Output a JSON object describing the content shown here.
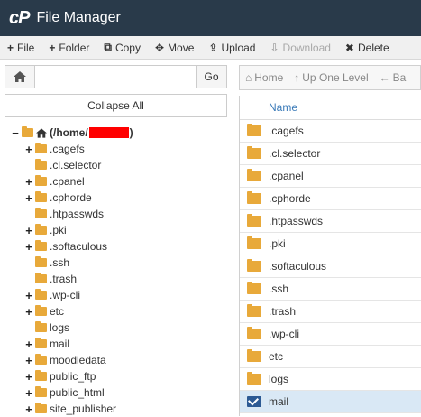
{
  "header": {
    "logo": "cP",
    "title": "File Manager"
  },
  "toolbar": [
    {
      "icon": "+",
      "label": "File",
      "name": "new-file-button",
      "disabled": false
    },
    {
      "icon": "+",
      "label": "Folder",
      "name": "new-folder-button",
      "disabled": false
    },
    {
      "icon": "⧉",
      "label": "Copy",
      "name": "copy-button",
      "disabled": false
    },
    {
      "icon": "✥",
      "label": "Move",
      "name": "move-button",
      "disabled": false
    },
    {
      "icon": "⇪",
      "label": "Upload",
      "name": "upload-button",
      "disabled": false
    },
    {
      "icon": "⇩",
      "label": "Download",
      "name": "download-button",
      "disabled": true
    },
    {
      "icon": "✖",
      "label": "Delete",
      "name": "delete-button",
      "disabled": false
    }
  ],
  "left": {
    "path_value": "",
    "go_label": "Go",
    "collapse_label": "Collapse All",
    "root_label": "(/home/",
    "root_suffix": ")",
    "tree": [
      {
        "label": ".cagefs",
        "toggle": "+"
      },
      {
        "label": ".cl.selector",
        "toggle": ""
      },
      {
        "label": ".cpanel",
        "toggle": "+"
      },
      {
        "label": ".cphorde",
        "toggle": "+"
      },
      {
        "label": ".htpasswds",
        "toggle": ""
      },
      {
        "label": ".pki",
        "toggle": "+"
      },
      {
        "label": ".softaculous",
        "toggle": "+"
      },
      {
        "label": ".ssh",
        "toggle": ""
      },
      {
        "label": ".trash",
        "toggle": ""
      },
      {
        "label": ".wp-cli",
        "toggle": "+"
      },
      {
        "label": "etc",
        "toggle": "+"
      },
      {
        "label": "logs",
        "toggle": ""
      },
      {
        "label": "mail",
        "toggle": "+"
      },
      {
        "label": "moodledata",
        "toggle": "+"
      },
      {
        "label": "public_ftp",
        "toggle": "+"
      },
      {
        "label": "public_html",
        "toggle": "+"
      },
      {
        "label": "site_publisher",
        "toggle": "+"
      }
    ]
  },
  "right": {
    "nav": [
      {
        "icon": "⌂",
        "label": "Home"
      },
      {
        "icon": "↑",
        "label": "Up One Level"
      },
      {
        "icon": "←",
        "label": "Ba"
      }
    ],
    "column_name": "Name",
    "files": [
      {
        "name": ".cagefs",
        "type": "folder"
      },
      {
        "name": ".cl.selector",
        "type": "folder"
      },
      {
        "name": ".cpanel",
        "type": "folder"
      },
      {
        "name": ".cphorde",
        "type": "folder"
      },
      {
        "name": ".htpasswds",
        "type": "folder"
      },
      {
        "name": ".pki",
        "type": "folder"
      },
      {
        "name": ".softaculous",
        "type": "folder"
      },
      {
        "name": ".ssh",
        "type": "folder"
      },
      {
        "name": ".trash",
        "type": "folder"
      },
      {
        "name": ".wp-cli",
        "type": "folder"
      },
      {
        "name": "etc",
        "type": "folder"
      },
      {
        "name": "logs",
        "type": "folder"
      },
      {
        "name": "mail",
        "type": "mail",
        "selected": true
      }
    ]
  }
}
